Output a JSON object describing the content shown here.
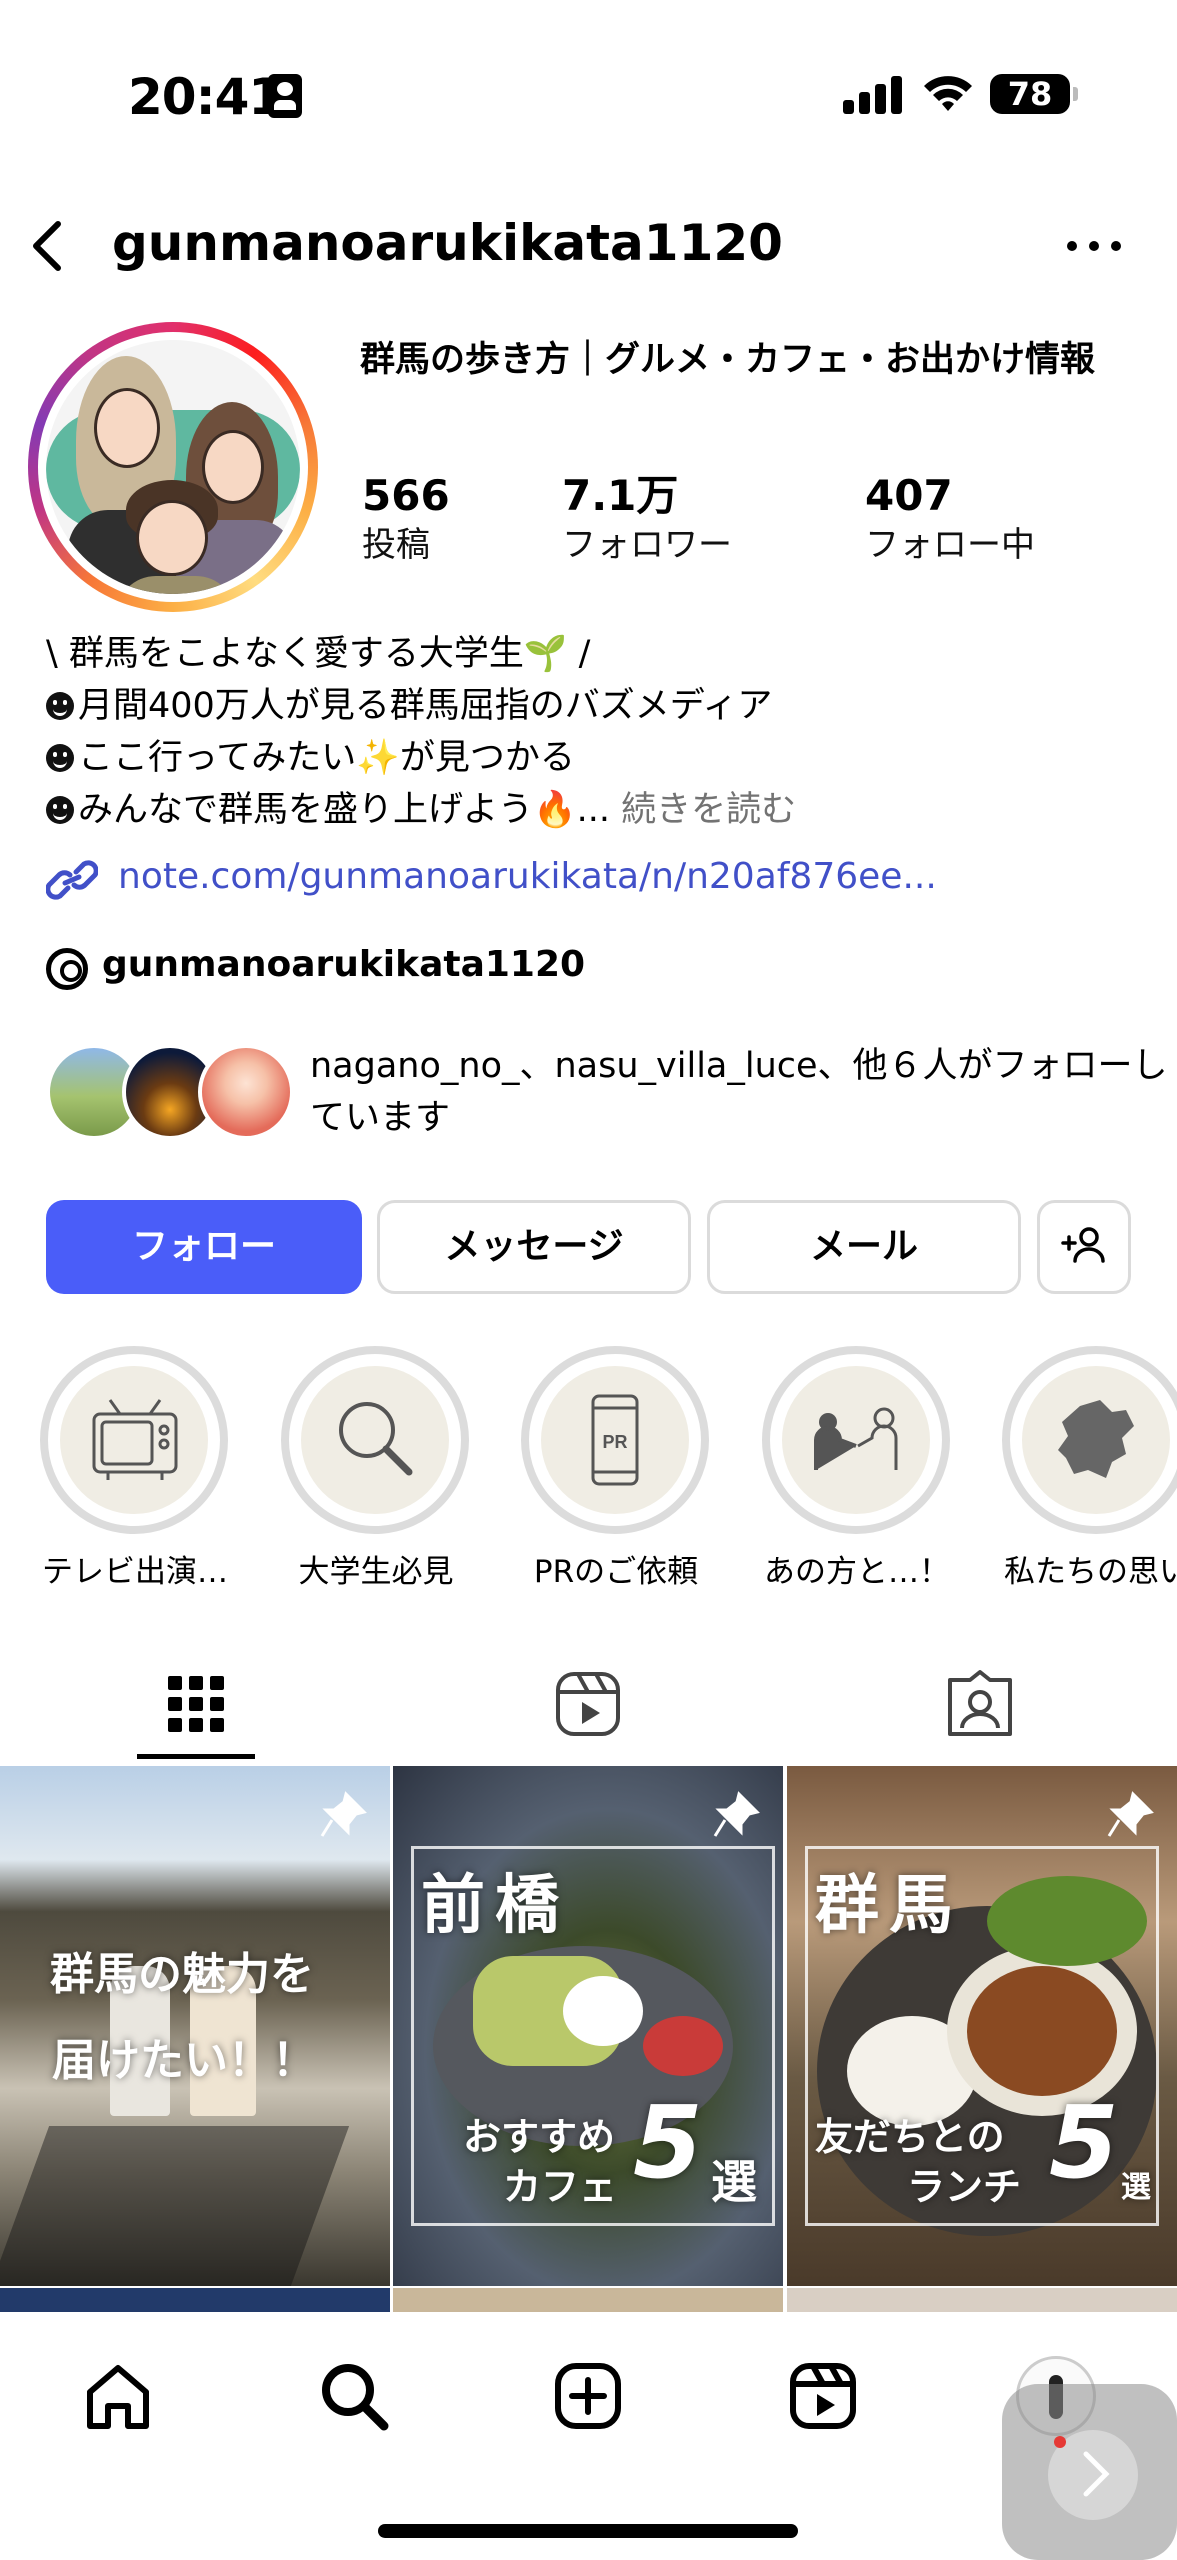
{
  "status_bar": {
    "time": "20:41",
    "battery": "78"
  },
  "header": {
    "username": "gunmanoarukikata1120"
  },
  "profile": {
    "display_name": "群馬の歩き方｜グルメ・カフェ・お出かけ情報",
    "stats": [
      {
        "value": "566",
        "label": "投稿"
      },
      {
        "value": "7.1万",
        "label": "フォロワー"
      },
      {
        "value": "407",
        "label": "フォロー中"
      }
    ],
    "bio": [
      "\\ 群馬をこよなく愛する大学生🌱 /",
      "月間400万人が見る群馬屈指のバズメディア",
      "ここ行ってみたい✨が見つかる",
      "みんなで群馬を盛り上げよう🔥..."
    ],
    "bio_more": "続きを読む",
    "link": "note.com/gunmanoarukikata/n/n20af876ee...",
    "threads": "gunmanoarukikata1120",
    "mutual": "nagano_no_、nasu_villa_luce、他６人がフォローしています"
  },
  "buttons": {
    "follow": "フォロー",
    "message": "メッセージ",
    "mail": "メール"
  },
  "highlights": [
    {
      "label": "テレビ出演…",
      "icon": "tv-icon"
    },
    {
      "label": "大学生必見",
      "icon": "magnifier-icon"
    },
    {
      "label": "PRのご依頼",
      "icon": "phone-pr-icon",
      "badge": "PR"
    },
    {
      "label": "あの方と…！",
      "icon": "handshake-icon"
    },
    {
      "label": "私たちの思い",
      "icon": "gunma-map-icon"
    }
  ],
  "posts": [
    {
      "line1": "群馬の魅力を",
      "line2": "届けたい！！"
    },
    {
      "title": "前橋",
      "sub1": "おすすめ",
      "sub2": "カフェ",
      "num": "5",
      "tail": "選"
    },
    {
      "title": "群馬",
      "sub1": "友だちとの",
      "sub2": "ランチ",
      "num": "5",
      "tail": "選"
    }
  ],
  "colors": {
    "follow_button": "#4a5df9",
    "link": "#4150c8"
  }
}
